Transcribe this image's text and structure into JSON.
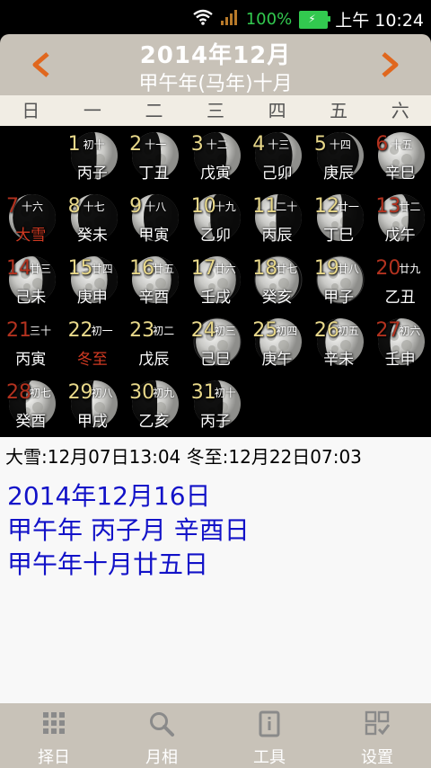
{
  "status_bar": {
    "battery": "100%",
    "time": "上午 10:24"
  },
  "header": {
    "title": "2014年12月",
    "subtitle": "甲午年(马年)十月"
  },
  "weekdays": [
    "日",
    "一",
    "二",
    "三",
    "四",
    "五",
    "六"
  ],
  "days": [
    {
      "day": "1",
      "lunar": "初十",
      "ganzhi": "丙子",
      "phase": 0.45
    },
    {
      "day": "2",
      "lunar": "十一",
      "ganzhi": "丁丑",
      "phase": 0.38
    },
    {
      "day": "3",
      "lunar": "十二",
      "ganzhi": "戊寅",
      "phase": 0.3
    },
    {
      "day": "4",
      "lunar": "十三",
      "ganzhi": "己卯",
      "phase": 0.2
    },
    {
      "day": "5",
      "lunar": "十四",
      "ganzhi": "庚辰",
      "phase": 0.1
    },
    {
      "day": "6",
      "lunar": "十五",
      "ganzhi": "辛巳",
      "phase": 0.0
    },
    {
      "day": "7",
      "lunar": "十六",
      "ganzhi": "大雪",
      "phase": -0.08
    },
    {
      "day": "8",
      "lunar": "十七",
      "ganzhi": "癸未",
      "phase": -0.15
    },
    {
      "day": "9",
      "lunar": "十八",
      "ganzhi": "甲寅",
      "phase": -0.25
    },
    {
      "day": "10",
      "lunar": "十九",
      "ganzhi": "乙卯",
      "phase": -0.35
    },
    {
      "day": "11",
      "lunar": "二十",
      "ganzhi": "丙辰",
      "phase": -0.45
    },
    {
      "day": "12",
      "lunar": "廿一",
      "ganzhi": "丁巳",
      "phase": -0.55
    },
    {
      "day": "13",
      "lunar": "廿二",
      "ganzhi": "戊午",
      "phase": -0.65
    },
    {
      "day": "14",
      "lunar": "廿三",
      "ganzhi": "己未",
      "phase": -0.72
    },
    {
      "day": "15",
      "lunar": "廿四",
      "ganzhi": "庚申",
      "phase": -0.78
    },
    {
      "day": "16",
      "lunar": "廿五",
      "ganzhi": "辛酉",
      "phase": -0.84
    },
    {
      "day": "17",
      "lunar": "廿六",
      "ganzhi": "壬戌",
      "phase": -0.9
    },
    {
      "day": "18",
      "lunar": "廿七",
      "ganzhi": "癸亥",
      "phase": -0.94
    },
    {
      "day": "19",
      "lunar": "廿八",
      "ganzhi": "甲子",
      "phase": -0.98
    },
    {
      "day": "20",
      "lunar": "廿九",
      "ganzhi": "乙丑",
      "phase": -1.0
    },
    {
      "day": "21",
      "lunar": "三十",
      "ganzhi": "丙寅",
      "phase": -1.0
    },
    {
      "day": "22",
      "lunar": "初一",
      "ganzhi": "冬至",
      "phase": 1.0
    },
    {
      "day": "23",
      "lunar": "初二",
      "ganzhi": "戊辰",
      "phase": 1.0
    },
    {
      "day": "24",
      "lunar": "初三",
      "ganzhi": "己巳",
      "phase": 0.96
    },
    {
      "day": "25",
      "lunar": "初四",
      "ganzhi": "庚午",
      "phase": 0.9
    },
    {
      "day": "26",
      "lunar": "初五",
      "ganzhi": "辛未",
      "phase": 0.82
    },
    {
      "day": "27",
      "lunar": "初六",
      "ganzhi": "壬申",
      "phase": 0.74
    },
    {
      "day": "28",
      "lunar": "初七",
      "ganzhi": "癸酉",
      "phase": 0.64
    },
    {
      "day": "29",
      "lunar": "初八",
      "ganzhi": "甲戌",
      "phase": 0.55
    },
    {
      "day": "30",
      "lunar": "初九",
      "ganzhi": "乙亥",
      "phase": 0.46
    },
    {
      "day": "31",
      "lunar": "初十",
      "ganzhi": "丙子",
      "phase": 0.38
    }
  ],
  "info": {
    "solar_terms": "大雪:12月07日13:04  冬至:12月22日07:03",
    "selected_date": "2014年12月16日",
    "selected_ganzhi": "甲午年 丙子月 辛酉日",
    "selected_lunar": "甲午年十月廿五日"
  },
  "bottom_nav": [
    "择日",
    "月相",
    "工具",
    "设置"
  ],
  "colors": {
    "accent_red": "#b3321f",
    "gold": "#e8d88a",
    "blue_text": "#1212c8",
    "header_bg": "#c8c2b8"
  }
}
